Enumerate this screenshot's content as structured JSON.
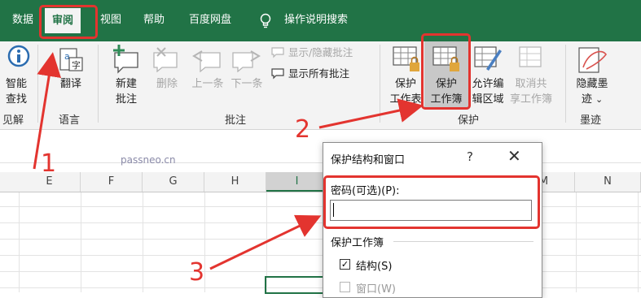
{
  "tabs": [
    "数据",
    "审阅",
    "视图",
    "帮助",
    "百度网盘",
    "操作说明搜索"
  ],
  "active_tab": "审阅",
  "ribbon": {
    "smart_lookup": [
      "智能",
      "查找"
    ],
    "translate": "翻译",
    "new_comment": [
      "新建",
      "批注"
    ],
    "delete": "删除",
    "previous": "上一条",
    "next": "下一条",
    "show_hide_comment": "显示/隐藏批注",
    "show_all_comments": "显示所有批注",
    "protect_sheet": [
      "保护",
      "工作表"
    ],
    "protect_workbook": [
      "保护",
      "工作簿"
    ],
    "allow_edit_ranges": [
      "允许编",
      "辑区域"
    ],
    "unshare_workbook": [
      "取消共",
      "享工作簿"
    ],
    "hide_ink": [
      "隐藏墨",
      "迹"
    ],
    "hide_ink_chevron": "⌄",
    "groups": {
      "insights": "见解",
      "language": "语言",
      "comments": "批注",
      "protect": "保护",
      "ink": "墨迹"
    }
  },
  "watermark": "passneo.cn",
  "columns": [
    "E",
    "F",
    "G",
    "H",
    "I",
    "M",
    "N"
  ],
  "selected_column": "I",
  "dialog": {
    "title": "保护结构和窗口",
    "help": "?",
    "close": "✕",
    "password_label": "密码(可选)(P):",
    "password_value": "",
    "protect_section": "保护工作簿",
    "structure_label": "结构(S)",
    "structure_checked": true,
    "windows_label": "窗口(W)",
    "windows_checked": false
  },
  "annotations": [
    "1",
    "2",
    "3"
  ],
  "colors": {
    "excel_green": "#217346",
    "annotation_red": "#e3342f"
  }
}
